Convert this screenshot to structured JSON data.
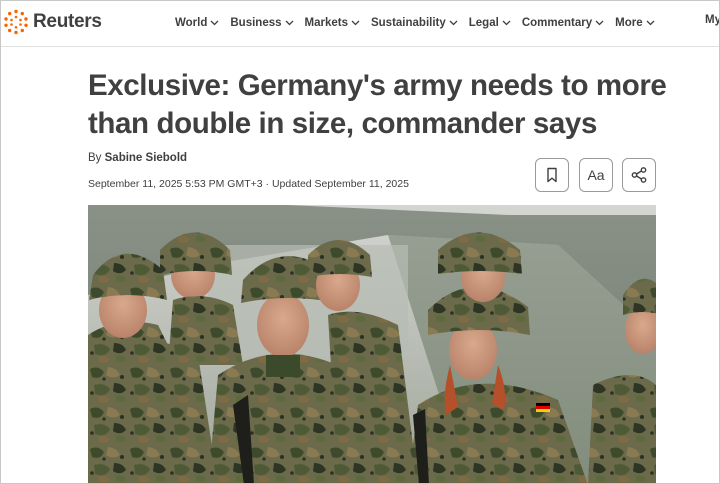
{
  "brand": {
    "name": "Reuters",
    "logo_icon": "reuters-dot-logo-icon",
    "accent_color": "#fa6400"
  },
  "nav": {
    "items": [
      {
        "label": "World"
      },
      {
        "label": "Business"
      },
      {
        "label": "Markets"
      },
      {
        "label": "Sustainability"
      },
      {
        "label": "Legal"
      },
      {
        "label": "Commentary"
      },
      {
        "label": "More"
      }
    ],
    "account_label": "My"
  },
  "article": {
    "headline": "Exclusive: Germany's army needs to more than double in size, commander says",
    "byline_prefix": "By ",
    "author": "Sabine Siebold",
    "dateline": "September 11, 2025 5:53 PM GMT+3 · Updated September 11, 2025",
    "tools": {
      "bookmark_icon": "bookmark-icon",
      "text_size_label": "Aa",
      "share_icon": "share-icon"
    },
    "image": {
      "subject": "soldiers-in-camouflage-photo"
    }
  }
}
